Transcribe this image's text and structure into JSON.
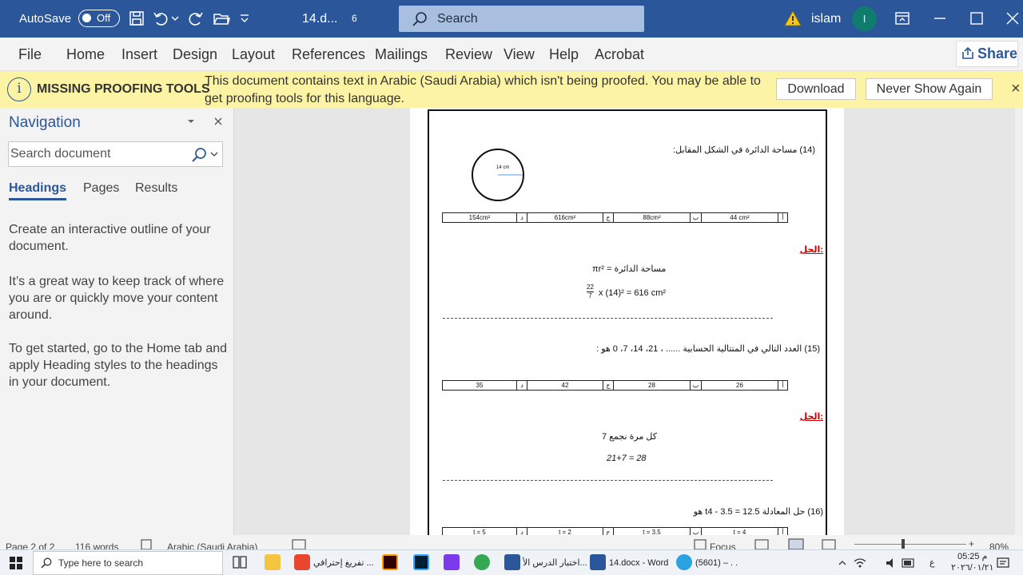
{
  "titlebar": {
    "autosave_label": "AutoSave",
    "autosave_state": "Off",
    "doc_name": "14.d...",
    "doc_num": "6",
    "search_label": "Search",
    "user_name": "islam",
    "avatar_initial": "I"
  },
  "ribbon": {
    "tabs": [
      "File",
      "Home",
      "Insert",
      "Design",
      "Layout",
      "References",
      "Mailings",
      "Review",
      "View",
      "Help",
      "Acrobat"
    ],
    "share_label": "Share"
  },
  "message_bar": {
    "title": "MISSING PROOFING TOOLS",
    "text": "This document contains text in Arabic (Saudi Arabia) which isn't being proofed. You may be able to get proofing tools for this language.",
    "download_label": "Download",
    "never_show_label": "Never Show Again",
    "close_glyph": "×"
  },
  "navigation": {
    "title": "Navigation",
    "search_placeholder": "Search document",
    "tabs": [
      "Headings",
      "Pages",
      "Results"
    ],
    "paragraphs": [
      "Create an interactive outline of your document.",
      "It’s a great way to keep track of where you are or quickly move your content around.",
      "To get started, go to the Home tab and apply Heading styles to the headings in your document."
    ]
  },
  "document": {
    "q14": "(14) مساحة الدائرة في الشكل المقابل:",
    "circle_label": "14 cm",
    "q14_options": [
      {
        "letter": "أ",
        "value": "44 cm²"
      },
      {
        "letter": "ب",
        "value": "88cm²"
      },
      {
        "letter": "ج",
        "value": "616cm²"
      },
      {
        "letter": "د",
        "value": "154cm²"
      }
    ],
    "solution_label": "الحل:",
    "q14_sol_1": "مساحة الدائرة = πr²",
    "q14_sol_2_frac_num": "22",
    "q14_sol_2_frac_den": "7",
    "q14_sol_2": "x (14)² = 616 cm²",
    "q15": "(15) العدد التالي في المتتالية الحسابية ...... ، 21، 14، 7، 0 هو :",
    "q15_options": [
      {
        "letter": "أ",
        "value": "26"
      },
      {
        "letter": "ب",
        "value": "28"
      },
      {
        "letter": "ج",
        "value": "42"
      },
      {
        "letter": "د",
        "value": "35"
      }
    ],
    "q15_sol_1": "كل مرة نجمع 7",
    "q15_sol_2": "21+7 = 28",
    "q16": "(16) حل المعادلة 12.5 = 3.5 - t4 هو",
    "q16_options": [
      {
        "letter": "أ",
        "value": "t = 4"
      },
      {
        "letter": "ب",
        "value": "t = 3.5"
      },
      {
        "letter": "ج",
        "value": "t = 2"
      },
      {
        "letter": "د",
        "value": "t = 5"
      }
    ]
  },
  "statusbar": {
    "page": "Page 2 of 2",
    "words": "116 words",
    "language": "Arabic (Saudi Arabia)",
    "focus": "Focus",
    "zoom": "80%"
  },
  "taskbar": {
    "search_placeholder": "Type here to search",
    "brave_label": "تفريغ إحترافي ...",
    "word1_label": "اختبار الدرس الأ...",
    "word2_label": "14.docx - Word",
    "telegram_label": "(5601) – . .",
    "time": "05:25 م",
    "date": "٢٠٢٦/٠١/٢١",
    "lang": "ع"
  },
  "colors": {
    "title_blue": "#2b579a",
    "message_yellow": "#fcf4a4",
    "avatar_teal": "#107c6e",
    "solution_red": "#cc0000"
  }
}
